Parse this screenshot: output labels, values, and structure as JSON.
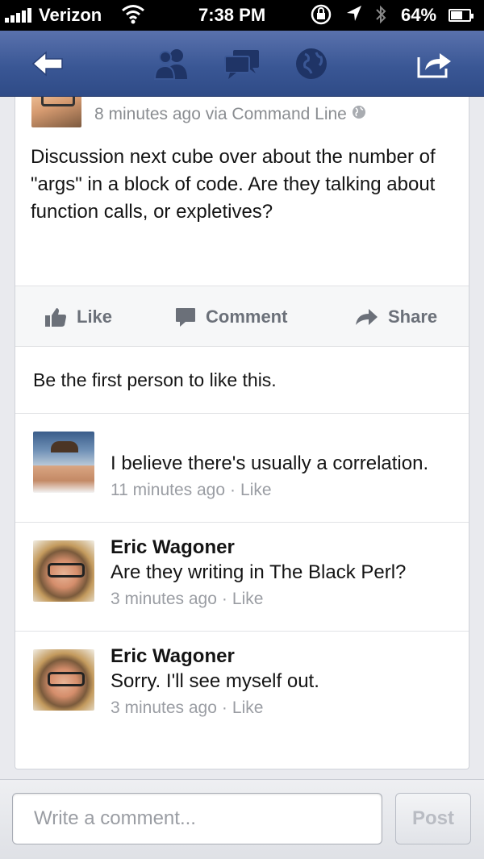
{
  "status_bar": {
    "carrier": "Verizon",
    "time": "7:38 PM",
    "battery_percent": "64%",
    "battery_level": 0.64,
    "icons": [
      "signal-icon",
      "wifi-icon",
      "rotation-lock-icon",
      "location-icon",
      "bluetooth-icon",
      "battery-icon"
    ]
  },
  "nav": {
    "icons": [
      "back-arrow-icon",
      "friends-icon",
      "messages-icon",
      "globe-icon",
      "share-icon"
    ]
  },
  "post": {
    "meta": "8 minutes ago via Command Line",
    "text": "Discussion next cube over about the number of \"args\" in a block of code. Are they talking about function calls, or expletives?"
  },
  "actions": {
    "like": "Like",
    "comment": "Comment",
    "share": "Share"
  },
  "likes_summary": "Be the first person to like this.",
  "comments": [
    {
      "name": "",
      "text": "I believe there's usually a correlation.",
      "time": "11 minutes ago",
      "like": "Like"
    },
    {
      "name": "Eric Wagoner",
      "text": "Are they writing in The Black Perl?",
      "time": "3 minutes ago",
      "like": "Like"
    },
    {
      "name": "Eric Wagoner",
      "text": "Sorry. I'll see myself out.",
      "time": "3 minutes ago",
      "like": "Like"
    }
  ],
  "composer": {
    "placeholder": "Write a comment...",
    "post_label": "Post"
  },
  "colors": {
    "nav_blue": "#3a5795",
    "link_gray": "#6b7079",
    "meta_gray": "#8a8d91"
  }
}
